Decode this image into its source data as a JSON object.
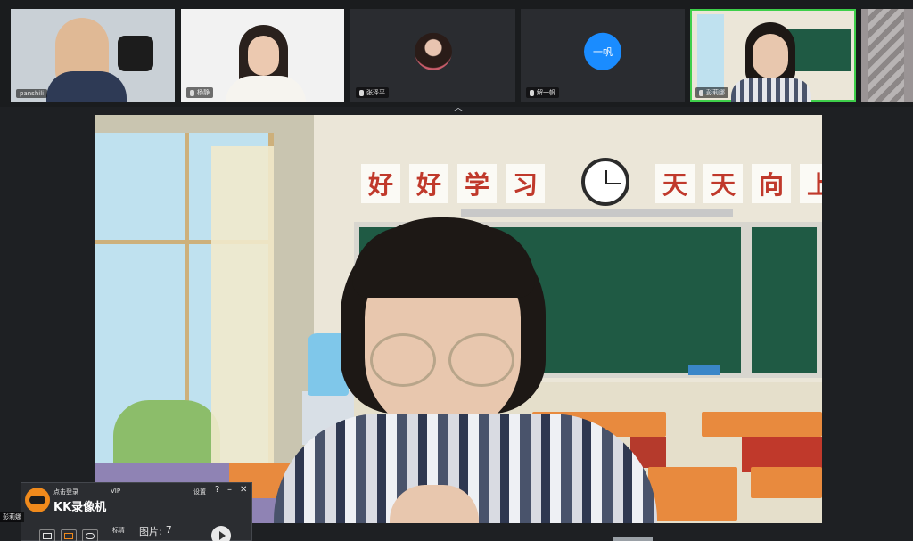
{
  "thumbnails": [
    {
      "name": "panshili",
      "has_mic": false
    },
    {
      "name": "杨静",
      "has_mic": true
    },
    {
      "name": "张泽平",
      "has_mic": true
    },
    {
      "name": "解一帆",
      "has_mic": true,
      "avatar_text": "一帆",
      "avatar_color": "#1a8cff"
    },
    {
      "name": "彭莉娜",
      "has_mic": true
    }
  ],
  "collapse_glyph": "︿",
  "main": {
    "slogan_left": [
      "好",
      "好",
      "学",
      "习"
    ],
    "slogan_right": [
      "天",
      "天",
      "向",
      "上"
    ]
  },
  "recorder": {
    "login": "点击登录",
    "vip": "VIP",
    "title": "KK录像机",
    "settings": "设置",
    "help": "?",
    "minimize": "–",
    "close": "✕",
    "quality": "标清",
    "pics_label": "图片:",
    "pics_count": "7"
  },
  "corner_name": "彭莉娜",
  "colors": {
    "active_border": "#3ecf4a",
    "recorder_accent": "#f08a1c"
  }
}
